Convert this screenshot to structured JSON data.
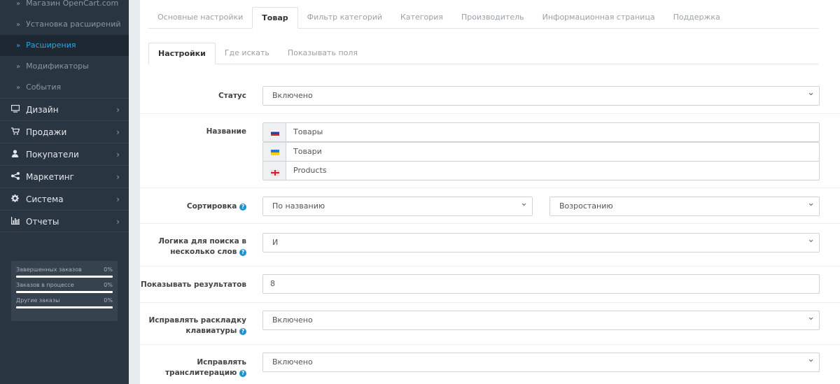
{
  "sidebar": {
    "sub_items": [
      {
        "label": "Магазин OpenCart.com",
        "active": false
      },
      {
        "label": "Установка расширений",
        "active": false
      },
      {
        "label": "Расширения",
        "active": true
      },
      {
        "label": "Модификаторы",
        "active": false
      },
      {
        "label": "События",
        "active": false
      }
    ],
    "main_items": [
      {
        "label": "Дизайн",
        "icon": "desktop-icon"
      },
      {
        "label": "Продажи",
        "icon": "shopping-cart-icon"
      },
      {
        "label": "Покупатели",
        "icon": "user-icon"
      },
      {
        "label": "Маркетинг",
        "icon": "share-icon"
      },
      {
        "label": "Система",
        "icon": "cog-icon"
      },
      {
        "label": "Отчеты",
        "icon": "bar-chart-icon"
      }
    ],
    "stats": [
      {
        "label": "Завершенных заказов",
        "value": "0%"
      },
      {
        "label": "Заказов в процессе",
        "value": "0%"
      },
      {
        "label": "Другие заказы",
        "value": "0%"
      }
    ]
  },
  "tabs_primary": [
    "Основные настройки",
    "Товар",
    "Фильтр категорий",
    "Категория",
    "Производитель",
    "Информационная страница",
    "Поддержка"
  ],
  "tabs_primary_active": "Товар",
  "tabs_secondary": [
    "Настройки",
    "Где искать",
    "Показывать поля"
  ],
  "tabs_secondary_active": "Настройки",
  "form": {
    "status": {
      "label": "Статус",
      "value": "Включено"
    },
    "name": {
      "label": "Название",
      "values": [
        {
          "lang": "ru",
          "value": "Товары"
        },
        {
          "lang": "ua",
          "value": "Товари"
        },
        {
          "lang": "en",
          "value": "Products"
        }
      ]
    },
    "sort": {
      "label": "Сортировка",
      "field": "По названию",
      "order": "Возростанию"
    },
    "logic": {
      "label_line1": "Логика для поиска в",
      "label_line2": "несколько слов",
      "value": "И"
    },
    "results": {
      "label": "Показывать результатов",
      "value": "8"
    },
    "keyboard": {
      "label_line1": "Исправлять раскладку",
      "label_line2": "клавиатуры",
      "value": "Включено"
    },
    "translit": {
      "label_line1": "Исправлять",
      "label_line2": "транслитерацию",
      "value": "Включено"
    }
  },
  "colors": {
    "sidebar_bg": "#2a3542",
    "active_link": "#2ea6e0",
    "help_icon": "#1e91cf"
  }
}
